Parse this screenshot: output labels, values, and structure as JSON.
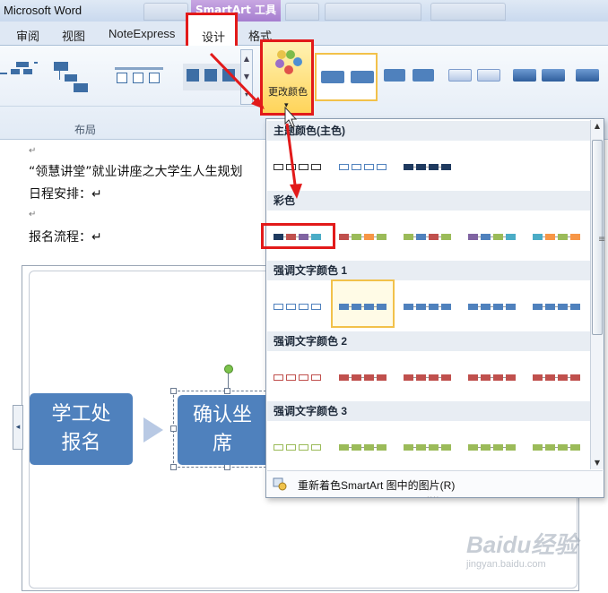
{
  "window": {
    "app_title": "Microsoft Word",
    "context_tab": "SmartArt 工具"
  },
  "tabs": [
    {
      "label": "审阅"
    },
    {
      "label": "视图"
    },
    {
      "label": "NoteExpress"
    },
    {
      "label": "设计"
    },
    {
      "label": "格式"
    }
  ],
  "ribbon": {
    "layout_group_label": "布局",
    "change_color_label": "更改颜色",
    "dropdown_arrow": "▾",
    "scroll_up": "▲",
    "scroll_down": "▼",
    "scroll_more": "▾"
  },
  "document": {
    "lines": [
      "“领慧讲堂”就业讲座之大学生人生规划",
      "日程安排：↵",
      "报名流程：↵"
    ],
    "para_mark": "↵"
  },
  "smartart": {
    "left_tab_glyph": "◂",
    "box1": "学工处报名",
    "box2": "确认坐席"
  },
  "dropdown": {
    "sections": [
      {
        "title": "主题颜色(主色)"
      },
      {
        "title": "彩色"
      },
      {
        "title": "强调文字颜色 1"
      },
      {
        "title": "强调文字颜色 2"
      },
      {
        "title": "强调文字颜色 3"
      }
    ],
    "footer_label": "重新着色SmartArt 图中的图片(R)",
    "scroll_up": "▲",
    "scroll_down": "▼",
    "grip": "≡",
    "bottom_grip": "····"
  },
  "colors": {
    "accent_blue": "#4f81bd",
    "highlight_red": "#e21a1a",
    "selection_gold": "#f2c14a",
    "accent2_red": "#c0504d",
    "accent3_green": "#9bbb59"
  },
  "watermark": {
    "logo": "Baidu经验",
    "sub": "jingyan.baidu.com"
  }
}
